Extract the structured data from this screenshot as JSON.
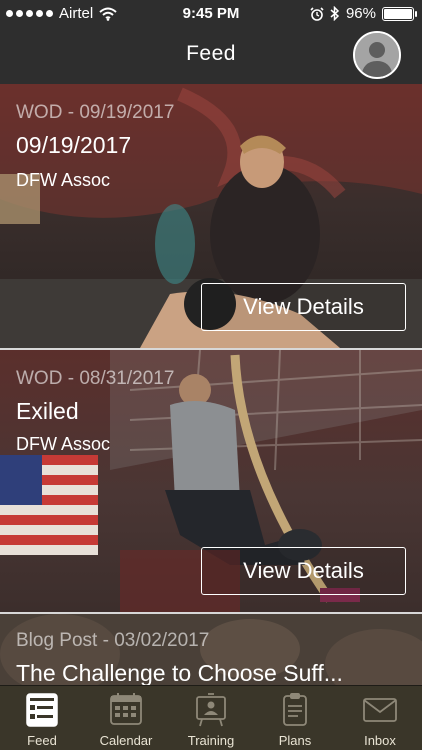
{
  "status_bar": {
    "carrier": "Airtel",
    "time": "9:45 PM",
    "battery": "96%",
    "battery_level": 0.96
  },
  "header": {
    "title": "Feed",
    "avatar_icon": "user-avatar-icon"
  },
  "feed": {
    "cards": [
      {
        "meta": "WOD - 09/19/2017",
        "title": "09/19/2017",
        "org": "DFW Assoc",
        "button": "View Details"
      },
      {
        "meta": "WOD - 08/31/2017",
        "title": "Exiled",
        "org": "DFW Assoc",
        "button": "View Details"
      },
      {
        "meta": "Blog Post - 03/02/2017",
        "title": "The Challenge to Choose Suff..."
      }
    ]
  },
  "tabbar": {
    "tabs": [
      {
        "label": "Feed",
        "icon": "feed-icon",
        "selected": true
      },
      {
        "label": "Calendar",
        "icon": "calendar-icon"
      },
      {
        "label": "Training",
        "icon": "training-icon"
      },
      {
        "label": "Plans",
        "icon": "plans-icon"
      },
      {
        "label": "Inbox",
        "icon": "inbox-icon"
      }
    ]
  }
}
